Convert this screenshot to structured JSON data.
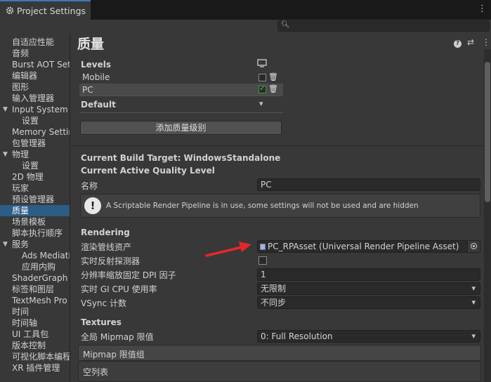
{
  "window": {
    "tab_title": "Project Settings",
    "kebab": "⋮"
  },
  "search": {
    "placeholder": ""
  },
  "sidebar": {
    "items": [
      {
        "label": "自适应性能",
        "indent": 1
      },
      {
        "label": "音频",
        "indent": 1
      },
      {
        "label": "Burst AOT Settings",
        "indent": 1
      },
      {
        "label": "编辑器",
        "indent": 1
      },
      {
        "label": "图形",
        "indent": 1
      },
      {
        "label": "输入管理器",
        "indent": 1
      },
      {
        "label": "Input System Package",
        "indent": 1,
        "expander": "▼"
      },
      {
        "label": "设置",
        "indent": 2
      },
      {
        "label": "Memory Settings",
        "indent": 1
      },
      {
        "label": "包管理器",
        "indent": 1
      },
      {
        "label": "物理",
        "indent": 1,
        "expander": "▼"
      },
      {
        "label": "设置",
        "indent": 2
      },
      {
        "label": "2D 物理",
        "indent": 1
      },
      {
        "label": "玩家",
        "indent": 1
      },
      {
        "label": "预设管理器",
        "indent": 1
      },
      {
        "label": "质量",
        "indent": 1,
        "selected": true
      },
      {
        "label": "场景模板",
        "indent": 1
      },
      {
        "label": "脚本执行顺序",
        "indent": 1
      },
      {
        "label": "服务",
        "indent": 1,
        "expander": "▼"
      },
      {
        "label": "Ads Mediation",
        "indent": 2
      },
      {
        "label": "应用内购",
        "indent": 2
      },
      {
        "label": "ShaderGraph",
        "indent": 1
      },
      {
        "label": "标签和图层",
        "indent": 1
      },
      {
        "label": "TextMesh Pro",
        "indent": 1
      },
      {
        "label": "时间",
        "indent": 1
      },
      {
        "label": "时间轴",
        "indent": 1
      },
      {
        "label": "UI 工具包",
        "indent": 1
      },
      {
        "label": "版本控制",
        "indent": 1
      },
      {
        "label": "可视化脚本编程",
        "indent": 1
      },
      {
        "label": "XR 插件管理",
        "indent": 1
      }
    ]
  },
  "main": {
    "title": "质量",
    "header_icons": {
      "help": "?",
      "presets": "⇄",
      "menu": "⋮"
    },
    "levels": {
      "heading": "Levels",
      "monitor_icon": "🖵",
      "rows": [
        {
          "name": "Mobile",
          "checked": false
        },
        {
          "name": "PC",
          "checked": true
        }
      ],
      "default_label": "Default",
      "add_button": "添加质量级别"
    },
    "build_target": "Current Build Target: WindowsStandalone",
    "active_level_heading": "Current Active Quality Level",
    "name_label": "名称",
    "name_value": "PC",
    "info_message": "A Scriptable Render Pipeline is in use, some settings will not be used and are hidden",
    "rendering": {
      "heading": "Rendering",
      "rp_asset_label": "渲染管线资产",
      "rp_asset_value": "PC_RPAsset (Universal Render Pipeline Asset)",
      "realtime_probes_label": "实时反射探测器",
      "dpi_label": "分辨率缩放固定 DPI 因子",
      "dpi_value": "1",
      "gi_label": "实时 GI CPU 使用率",
      "gi_value": "无限制",
      "vsync_label": "VSync 计数",
      "vsync_value": "不同步"
    },
    "textures": {
      "heading": "Textures",
      "mipmap_label": "全局 Mipmap 限值",
      "mipmap_value": "0: Full Resolution",
      "mipmap_group_label": "Mipmap 限值组",
      "empty_list": "空列表"
    }
  },
  "annotation": {
    "arrow_color": "#e8262a"
  }
}
